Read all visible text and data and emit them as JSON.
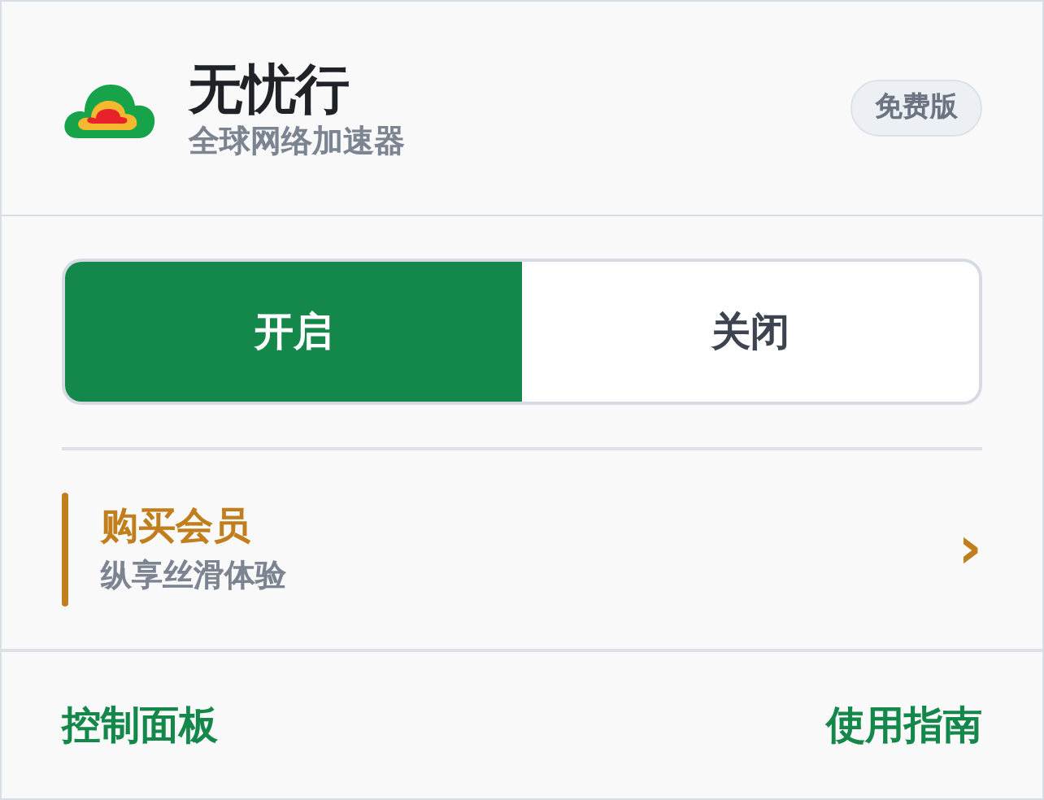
{
  "header": {
    "title": "无忧行",
    "subtitle": "全球网络加速器",
    "badge": "免费版"
  },
  "toggle": [
    {
      "label": "开启",
      "selected": true
    },
    {
      "label": "关闭",
      "selected": false
    }
  ],
  "promo": {
    "title": "购买会员",
    "subtitle": "纵享丝滑体验",
    "chevron": "›"
  },
  "footer_links": [
    {
      "label": "控制面板"
    },
    {
      "label": "使用指南"
    }
  ]
}
